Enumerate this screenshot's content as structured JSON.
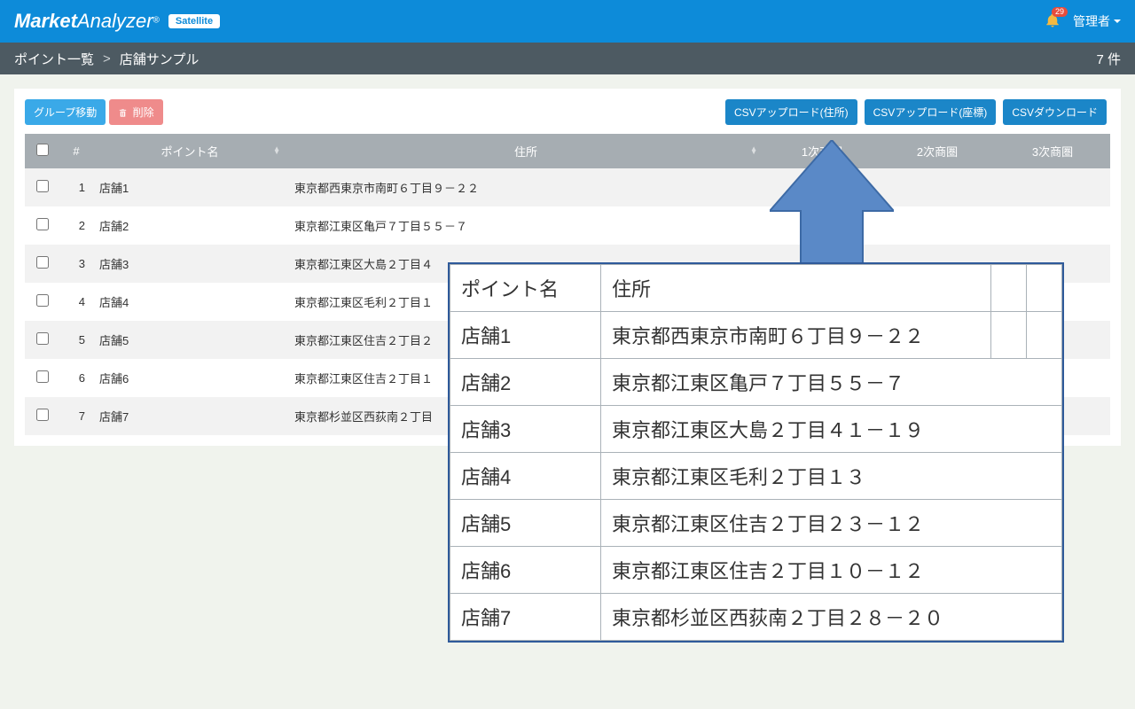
{
  "header": {
    "logo_market": "Market",
    "logo_analyzer": "Analyzer",
    "logo_reg": "®",
    "logo_badge": "Satellite",
    "notifications": "29",
    "user_label": "管理者"
  },
  "breadcrumb": {
    "first": "ポイント一覧",
    "sep": ">",
    "second": "店舗サンプル",
    "count": "7 件"
  },
  "actions": {
    "group_move": "グループ移動",
    "delete": "削除",
    "csv_upload_addr": "CSVアップロード(住所)",
    "csv_upload_coord": "CSVアップロード(座標)",
    "csv_download": "CSVダウンロード"
  },
  "table": {
    "headers": {
      "num": "#",
      "name": "ポイント名",
      "addr": "住所",
      "zone1": "1次商圏",
      "zone2": "2次商圏",
      "zone3": "3次商圏"
    },
    "rows": [
      {
        "num": "1",
        "name": "店舗1",
        "addr": "東京都西東京市南町６丁目９－２２"
      },
      {
        "num": "2",
        "name": "店舗2",
        "addr": "東京都江東区亀戸７丁目５５－７"
      },
      {
        "num": "3",
        "name": "店舗3",
        "addr": "東京都江東区大島２丁目４"
      },
      {
        "num": "4",
        "name": "店舗4",
        "addr": "東京都江東区毛利２丁目１"
      },
      {
        "num": "5",
        "name": "店舗5",
        "addr": "東京都江東区住吉２丁目２"
      },
      {
        "num": "6",
        "name": "店舗6",
        "addr": "東京都江東区住吉２丁目１"
      },
      {
        "num": "7",
        "name": "店舗7",
        "addr": "東京都杉並区西荻南２丁目"
      }
    ]
  },
  "overlay": {
    "headers": {
      "name": "ポイント名",
      "addr": "住所"
    },
    "rows": [
      {
        "name": "店舗1",
        "addr": "東京都西東京市南町６丁目９－２２"
      },
      {
        "name": "店舗2",
        "addr": "東京都江東区亀戸７丁目５５－７"
      },
      {
        "name": "店舗3",
        "addr": "東京都江東区大島２丁目４１－１９"
      },
      {
        "name": "店舗4",
        "addr": "東京都江東区毛利２丁目１３"
      },
      {
        "name": "店舗5",
        "addr": "東京都江東区住吉２丁目２３－１２"
      },
      {
        "name": "店舗6",
        "addr": "東京都江東区住吉２丁目１０－１２"
      },
      {
        "name": "店舗7",
        "addr": "東京都杉並区西荻南２丁目２８－２０"
      }
    ]
  }
}
